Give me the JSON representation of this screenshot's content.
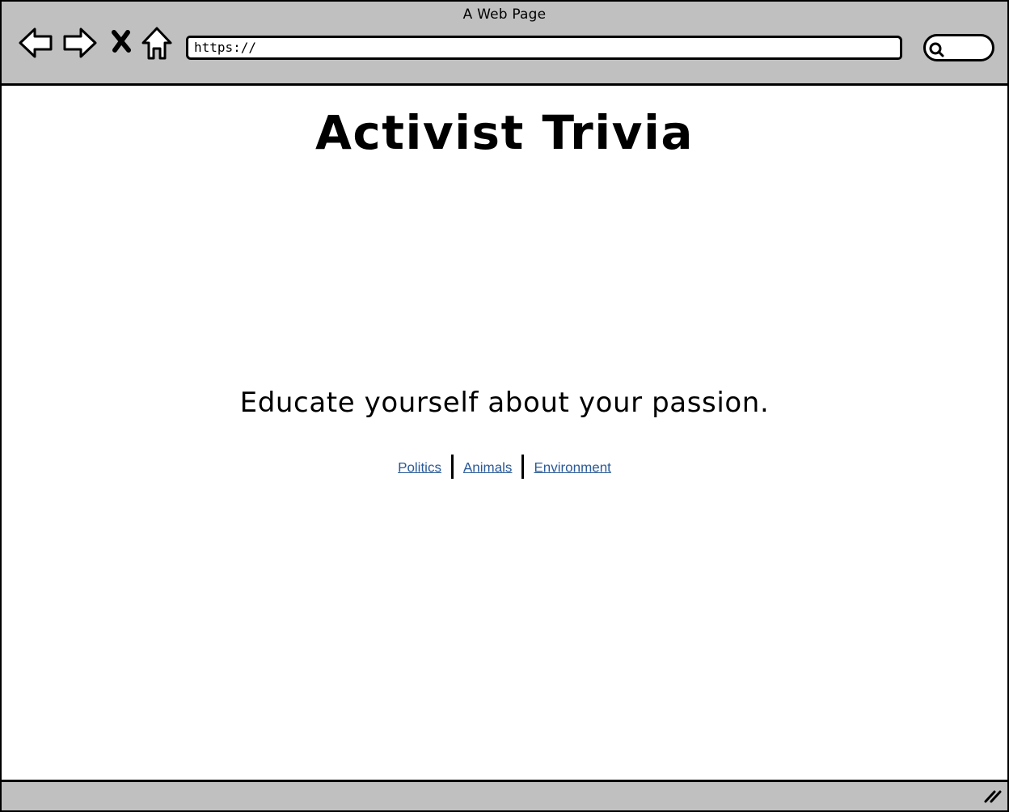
{
  "window": {
    "title": "A Web Page"
  },
  "toolbar": {
    "back_icon": "back-arrow-icon",
    "forward_icon": "forward-arrow-icon",
    "stop_icon": "close-icon",
    "home_icon": "home-icon",
    "url": "https://",
    "search_icon": "search-icon"
  },
  "page": {
    "title": "Activist Trivia",
    "tagline": "Educate yourself about your passion.",
    "links": [
      {
        "label": "Politics"
      },
      {
        "label": "Animals"
      },
      {
        "label": "Environment"
      }
    ]
  },
  "colors": {
    "chrome": "#c0c0c0",
    "link": "#2a5a98"
  }
}
